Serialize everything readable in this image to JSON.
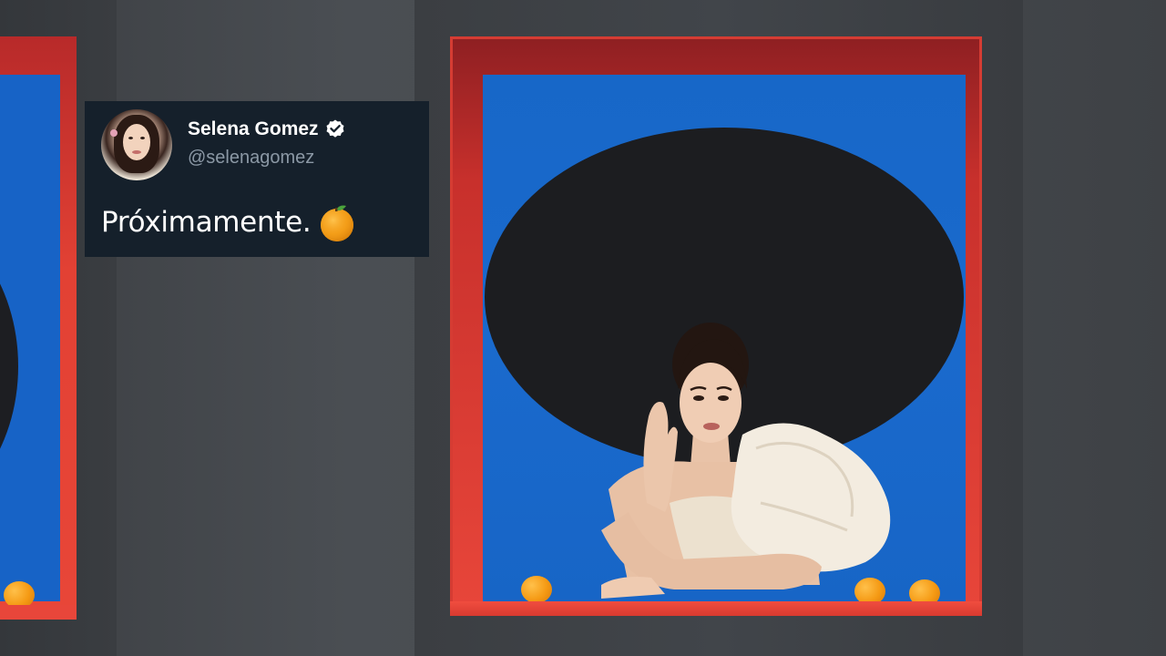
{
  "tweet": {
    "display_name": "Selena Gomez",
    "handle": "@selenagomez",
    "verified": true,
    "text": "Próximamente.",
    "emoji": "orange-emoji-icon"
  },
  "colors": {
    "wall": "#474b50",
    "frame_red": "#e8463a",
    "backdrop_blue": "#1767c8",
    "oval_black": "#1c1d20",
    "tweet_bg": "#15202b",
    "handle_gray": "#8b98a5",
    "orange": "#f59a14"
  }
}
